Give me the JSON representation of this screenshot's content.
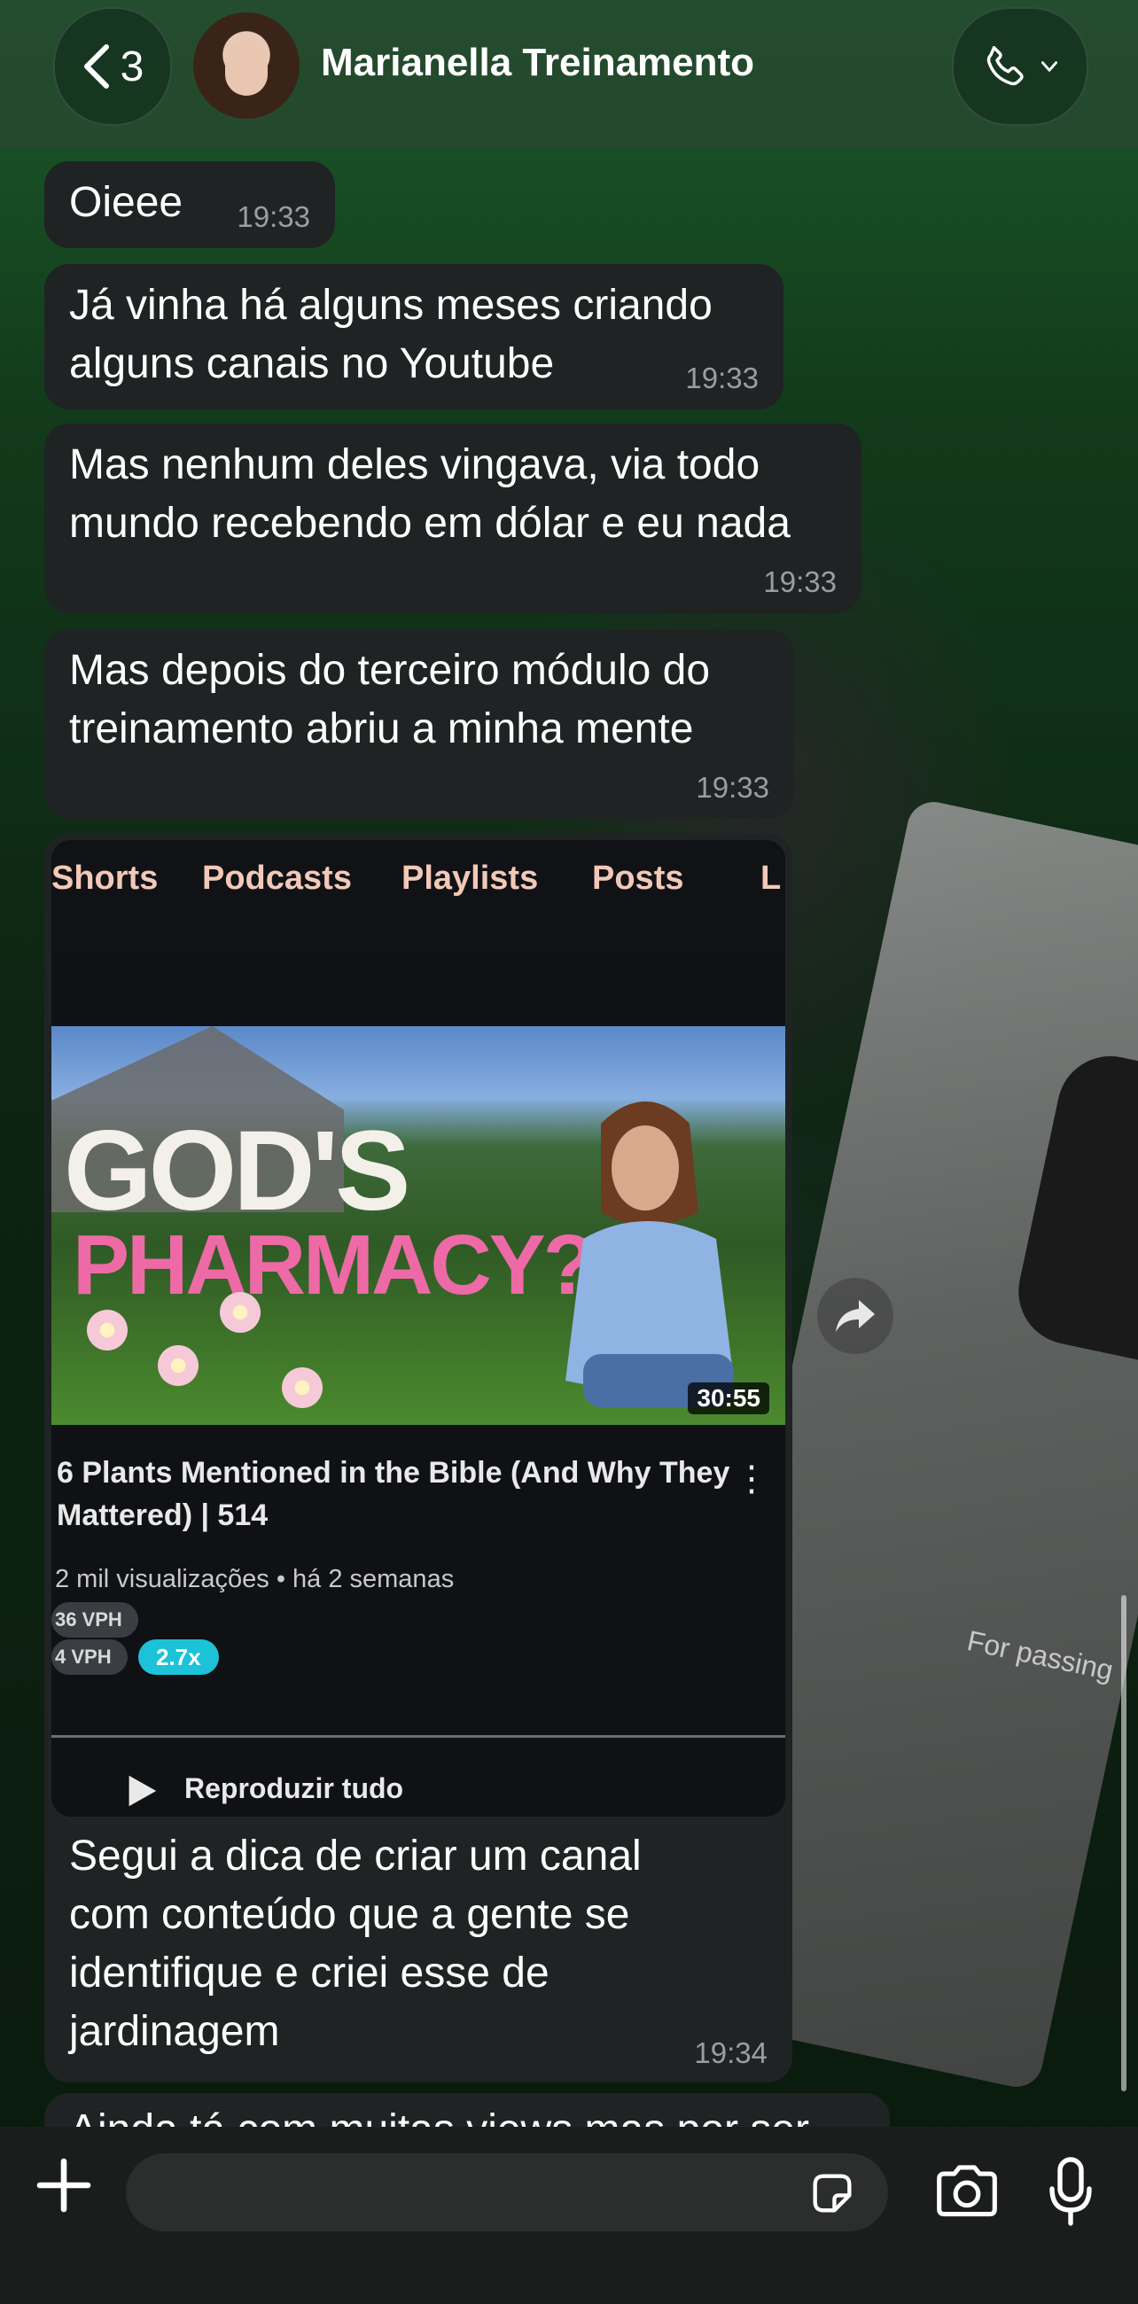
{
  "header": {
    "back_count": "3",
    "contact_name": "Marianella Treinamento"
  },
  "messages": [
    {
      "text": "Oieee",
      "time": "19:33"
    },
    {
      "text": "Já vinha há alguns meses criando\nalguns canais no Youtube",
      "time": "19:33"
    },
    {
      "text": "Mas nenhum deles vingava, via todo\nmundo recebendo em dólar e eu nada",
      "time": "19:33"
    },
    {
      "text": "Mas depois do terceiro módulo do\ntreinamento abriu a minha mente",
      "time": "19:33"
    }
  ],
  "media_message": {
    "screenshot": {
      "tabs": [
        "Shorts",
        "Podcasts",
        "Playlists",
        "Posts",
        "L"
      ],
      "thumb_text_line1": "GOD'S",
      "thumb_text_line2": "PHARMACY?",
      "duration": "30:55",
      "video_title": "6 Plants Mentioned in the Bible (And Why They\nMattered) | 514",
      "meta": "2 mil visualizações • há 2 semanas",
      "vph1": "36 VPH",
      "vph2": "4 VPH",
      "badge": "2.7x",
      "play_all": "Reproduzir tudo",
      "plaque_text": "For passing"
    },
    "caption": "Segui a dica de criar um canal\ncom conteúdo que a gente se\nidentifique e criei esse de\njardinagem",
    "time": "19:34"
  },
  "partial_message": {
    "text": "Ainda tá com muitas views mas por ser"
  },
  "composer": {
    "placeholder": ""
  }
}
